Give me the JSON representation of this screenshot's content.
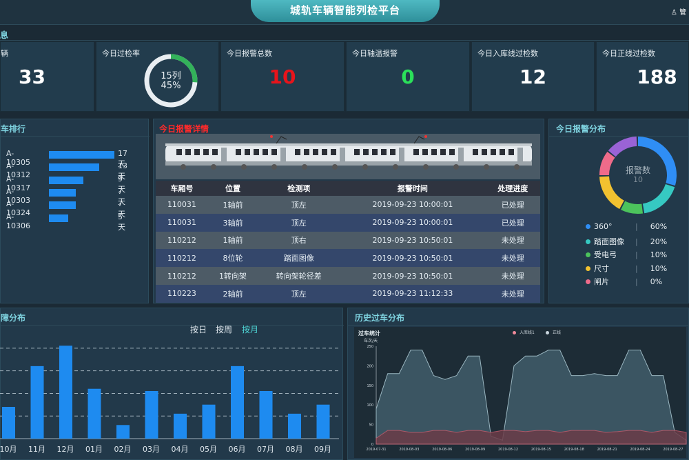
{
  "header": {
    "title": "城轨车辆智能列检平台",
    "user": "♙ 管"
  },
  "sections": {
    "info": "息",
    "rank": "车排行",
    "alarm_detail": "今日报警详情",
    "alarm_dist": "今日报警分布",
    "fault_dist": "障分布",
    "history": "历史过车分布"
  },
  "stats": [
    {
      "label": "辆",
      "value": "33"
    },
    {
      "label": "今日过检率",
      "ring_top": "15列",
      "ring_bottom": "45%",
      "progress": 0.45
    },
    {
      "label": "今日报警总数",
      "value": "10",
      "color": "#e8141b"
    },
    {
      "label": "今日轴温报警",
      "value": "0",
      "color": "#2be05a"
    },
    {
      "label": "今日入库线过检数",
      "value": "12"
    },
    {
      "label": "今日正线过检数",
      "value": "188"
    }
  ],
  "ranking": [
    {
      "name": "A-10305",
      "days": "17天",
      "value": 17
    },
    {
      "name": "A-10312",
      "days": "13天",
      "value": 13
    },
    {
      "name": "A-10317",
      "days": "9天",
      "value": 9
    },
    {
      "name": "A-10303",
      "days": "7天",
      "value": 7
    },
    {
      "name": "A-10324",
      "days": "7天",
      "value": 7
    },
    {
      "name": "A-10306",
      "days": "5天",
      "value": 5
    }
  ],
  "alarm_table": {
    "headers": [
      "车厢号",
      "位置",
      "检测项",
      "报警时间",
      "处理进度"
    ],
    "rows": [
      [
        "110031",
        "1轴前",
        "顶左",
        "2019-09-23 10:00:01",
        "已处理"
      ],
      [
        "110031",
        "3轴前",
        "顶左",
        "2019-09-23 10:00:01",
        "已处理"
      ],
      [
        "110212",
        "1轴前",
        "顶右",
        "2019-09-23 10:50:01",
        "未处理"
      ],
      [
        "110212",
        "8位轮",
        "踏面图像",
        "2019-09-23 10:50:01",
        "未处理"
      ],
      [
        "110212",
        "1转向架",
        "转向架轮径差",
        "2019-09-23 10:50:01",
        "未处理"
      ],
      [
        "110223",
        "2轴前",
        "顶左",
        "2019-09-23 11:12:33",
        "未处理"
      ]
    ]
  },
  "alarm_pie": {
    "center_label": "报警数",
    "center_value": "10",
    "items": [
      {
        "name": "360°",
        "pct": "60%",
        "color": "#2f8ef5"
      },
      {
        "name": "踏面图像",
        "pct": "20%",
        "color": "#36c9c2"
      },
      {
        "name": "受电弓",
        "pct": "10%",
        "color": "#4cc35c"
      },
      {
        "name": "尺寸",
        "pct": "10%",
        "color": "#f2c230"
      },
      {
        "name": "闸片",
        "pct": "0%",
        "color": "#ef6b8a"
      }
    ],
    "ring_colors": [
      "#2f8ef5",
      "#36c9c2",
      "#4cc35c",
      "#f2c230",
      "#ef6b8a",
      "#9a63d6"
    ]
  },
  "fault_tabs": {
    "day": "按日",
    "week": "按周",
    "month": "按月"
  },
  "chart_data": [
    {
      "type": "bar",
      "categories": [
        "10月",
        "11月",
        "12月",
        "01月",
        "02月",
        "03月",
        "04月",
        "05月",
        "06月",
        "07月",
        "08月",
        "09月"
      ],
      "values": [
        14,
        32,
        41,
        22,
        6,
        21,
        11,
        15,
        32,
        21,
        11,
        15
      ],
      "ylim": [
        0,
        42
      ],
      "grid": true,
      "color": "#1e8bf0"
    },
    {
      "type": "area",
      "title": "过车统计",
      "ylabel": "车次/天",
      "legend": [
        "入库线1",
        "正线"
      ],
      "legend_colors": [
        "#f08a9a",
        "#c9d5dd"
      ],
      "ylim": [
        0,
        250
      ],
      "yticks": [
        0,
        50,
        100,
        150,
        200,
        250
      ],
      "x": [
        "2019-07-31",
        "2019-08-03",
        "2019-08-06",
        "2019-08-09",
        "2019-08-12",
        "2019-08-15",
        "2019-08-18",
        "2019-08-21",
        "2019-08-24",
        "2019-08-27"
      ],
      "series": [
        {
          "name": "入库线1",
          "values": [
            15,
            35,
            35,
            30,
            30,
            35,
            35,
            30,
            35,
            35,
            30,
            35,
            35,
            32,
            35,
            35,
            30,
            35,
            35,
            35,
            30,
            32,
            35,
            35,
            30,
            35,
            35,
            30
          ]
        },
        {
          "name": "正线",
          "values": [
            90,
            180,
            180,
            240,
            240,
            175,
            165,
            175,
            225,
            225,
            20,
            10,
            200,
            225,
            225,
            240,
            240,
            175,
            175,
            180,
            175,
            175,
            240,
            240,
            175,
            175,
            30,
            10
          ]
        }
      ]
    }
  ]
}
